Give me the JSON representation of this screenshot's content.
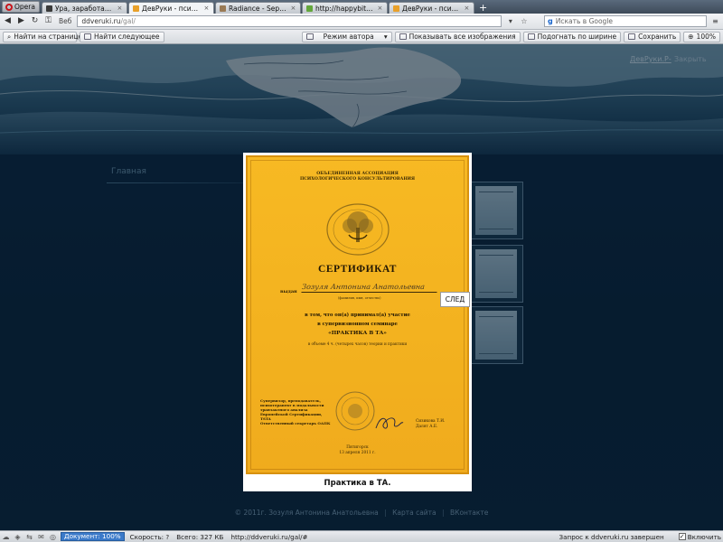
{
  "browser": {
    "opera_label": "Opera",
    "tabs": [
      {
        "label": "Ура, заработало!",
        "icon_color": "#3a3a3a",
        "active": false
      },
      {
        "label": "ДевРуки - психолог-к...",
        "icon_color": "#e8a02a",
        "active": true
      },
      {
        "label": "Radiance - September ...",
        "icon_color": "#9a7a55",
        "active": false
      },
      {
        "label": "http://happybithday/",
        "icon_color": "#63a63b",
        "active": false
      },
      {
        "label": "ДевРуки - психолог-к...",
        "icon_color": "#e8a02a",
        "active": false
      }
    ],
    "web_label": "Веб",
    "url_domain": "ddveruki.ru",
    "url_path": "/gal/",
    "search_placeholder": "Искать в Google",
    "toolbar": {
      "find_placeholder": "Найти на странице",
      "find_next": "Найти следующее",
      "author_mode": "Режим автора",
      "show_images": "Показывать все изображения",
      "fit_width": "Подогнать по ширине",
      "save": "Сохранить",
      "zoom": "100%"
    }
  },
  "page": {
    "header_user": "ДевРуки.Р-",
    "header_close": "Закрыть",
    "nav_home": "Главная",
    "footer": {
      "copyright": "© 2011г. Зозуля Антонина Анатольевна",
      "sitemap": "Карта сайта",
      "vk": "ВКонтакте"
    }
  },
  "lightbox": {
    "next_label": "СЛЕД",
    "caption": "Практика в ТА.",
    "certificate": {
      "org": "ОБЪЕДИНЕННАЯ АССОЦИАЦИЯ\nПСИХОЛОГИЧЕСКОГО КОНСУЛЬТИРОВАНИЯ",
      "title": "СЕРТИФИКАТ",
      "issued": "выдан",
      "name": "Зозуля Антонина Анатольевна",
      "name_hint": "(фамилия, имя, отчество)",
      "line1": "в том, что он(а) принимал(а) участие",
      "line2": "в супервизионном семинаре",
      "line3": "«ПРАКТИКА В ТА»",
      "line4": "в объеме 4 ч. (четырех часов) теории и практики",
      "sign_left": "Супервизор, преподаватель,\nпсихотерапевт в модальности\nтранзактного анализа\nЕвропейской Сертификации,\nTSTA\nОтветственный секретарь ОАПК",
      "sign_right": "Сизикова Т.И.\nДалят А.Е.",
      "place": "Пятигорск\n13 апреля 2011 г."
    }
  },
  "status": {
    "doc_label": "Документ: 100%",
    "speed": "Скорость: ?",
    "total": "Всего: 327 КБ",
    "url": "http://ddveruki.ru/gal/#",
    "message": "Запрос к ddveruki.ru завершен",
    "enable_label": "Включить"
  },
  "colors": {
    "page_bg": "#0c2a44",
    "certificate": "#f3b21f",
    "accent_link": "#cfe6f3"
  }
}
